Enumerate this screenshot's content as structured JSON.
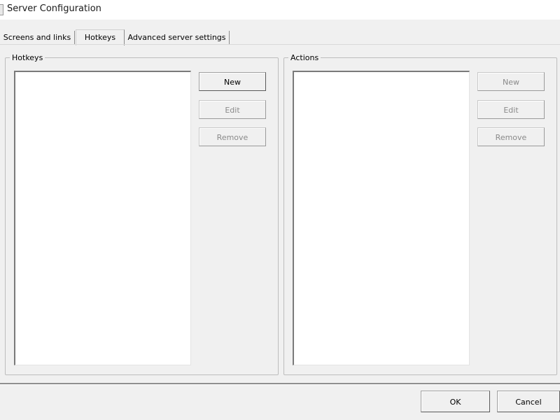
{
  "window": {
    "title": "Server Configuration"
  },
  "tabs": [
    {
      "label": "Screens and links",
      "active": false
    },
    {
      "label": "Hotkeys",
      "active": true
    },
    {
      "label": "Advanced server settings",
      "active": false
    }
  ],
  "hotkeys_group": {
    "label": "Hotkeys",
    "items": [],
    "buttons": {
      "new": {
        "label": "New",
        "enabled": true
      },
      "edit": {
        "label": "Edit",
        "enabled": false
      },
      "remove": {
        "label": "Remove",
        "enabled": false
      }
    }
  },
  "actions_group": {
    "label": "Actions",
    "items": [],
    "buttons": {
      "new": {
        "label": "New",
        "enabled": false
      },
      "edit": {
        "label": "Edit",
        "enabled": false
      },
      "remove": {
        "label": "Remove",
        "enabled": false
      }
    }
  },
  "footer": {
    "ok_label": "OK",
    "cancel_label": "Cancel"
  }
}
